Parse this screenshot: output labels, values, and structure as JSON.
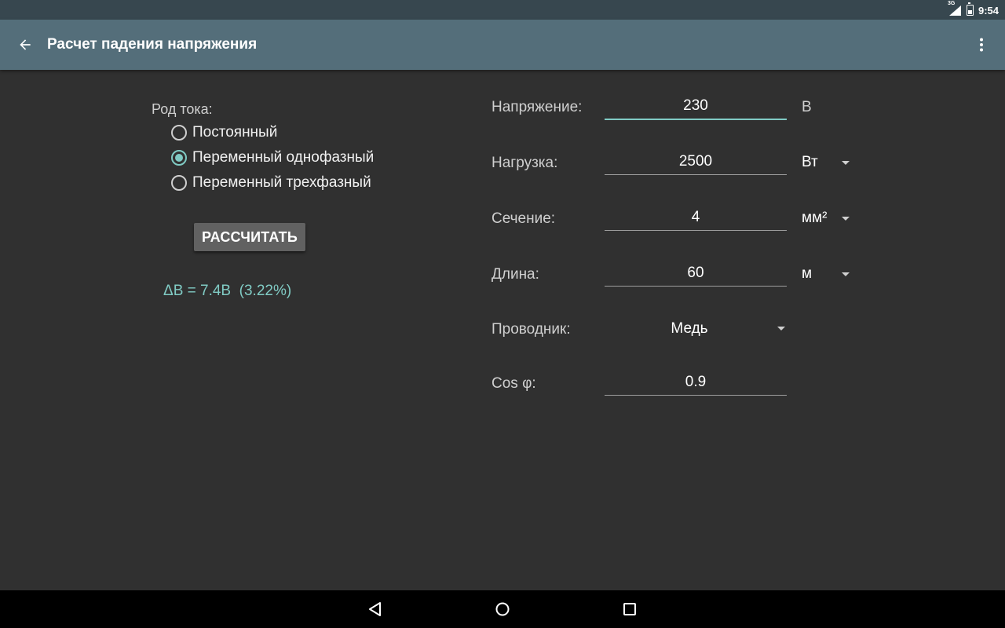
{
  "status_bar": {
    "network": "3G",
    "time": "9:54"
  },
  "app_bar": {
    "title": "Расчет падения напряжения",
    "back_icon": "arrow-back-icon",
    "menu_icon": "more-vert-icon"
  },
  "current_type": {
    "label": "Род тока:",
    "options": [
      {
        "label": "Постоянный",
        "checked": false
      },
      {
        "label": "Переменный однофазный",
        "checked": true
      },
      {
        "label": "Переменный трехфазный",
        "checked": false
      }
    ]
  },
  "calculate_button": "РАССЧИТАТЬ",
  "result": "ΔВ = 7.4В  (3.22%)",
  "fields": {
    "voltage": {
      "label": "Напряжение:",
      "value": "230",
      "unit": "В"
    },
    "load": {
      "label": "Нагрузка:",
      "value": "2500",
      "unit": "Вт"
    },
    "section": {
      "label": "Сечение:",
      "value": "4",
      "unit": "мм²"
    },
    "length": {
      "label": "Длина:",
      "value": "60",
      "unit": "м"
    },
    "conductor": {
      "label": "Проводник:",
      "value": "Медь"
    },
    "cos_phi": {
      "label": "Cos φ:",
      "value": "0.9"
    }
  },
  "colors": {
    "accent": "#80cbc4",
    "app_bar": "#546e7a",
    "status_bar": "#37474f",
    "background": "#303030"
  }
}
